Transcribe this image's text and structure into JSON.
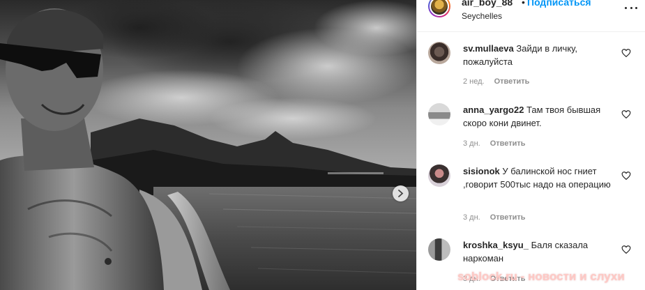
{
  "post": {
    "username": "air_boy_88",
    "separator": "•",
    "follow_label": "Подписаться",
    "location": "Seychelles",
    "more_icon": "more-horizontal-icon",
    "next_icon": "chevron-right-icon"
  },
  "comments": [
    {
      "username": "sv.mullaeva",
      "text": "Зайди в личку, пожалуйста",
      "time": "2 нед.",
      "reply_label": "Ответить",
      "avatar": "avatar-photo",
      "like_icon": "heart-icon"
    },
    {
      "username": "anna_yargo22",
      "text": "Там твоя бывшая скоро кони двинет.",
      "time": "3 дн.",
      "reply_label": "Ответить",
      "avatar": "avatar-photo",
      "like_icon": "heart-icon"
    },
    {
      "username": "sisionok",
      "text": "У балинской нос гниет ,говорит 500тыс надо на операцию",
      "time": "3 дн.",
      "reply_label": "Ответить",
      "avatar": "avatar-photo",
      "like_icon": "heart-icon"
    },
    {
      "username": "kroshka_ksyu_",
      "text": "Баля сказала наркоман",
      "time": "3 дн.",
      "reply_label": "Ответить",
      "avatar": "avatar-photo",
      "like_icon": "heart-icon"
    }
  ],
  "watermark": "soblock.ru - новости и слухи",
  "colors": {
    "accent": "#0095f6",
    "text": "#262626",
    "secondary": "#8e8e8e",
    "border": "#efefef"
  }
}
